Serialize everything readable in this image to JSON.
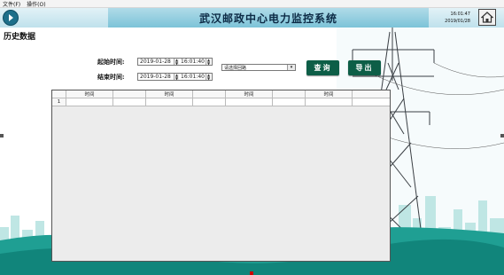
{
  "menu": [
    "文件(F)",
    "操作(O)"
  ],
  "header": {
    "title": "武汉邮政中心电力监控系统",
    "time": "16:01:47",
    "date": "2019/01/28"
  },
  "page_title": "历史数据",
  "form": {
    "start_label": "起始时间:",
    "end_label": "结束时间:",
    "start_date": "2019-01-28",
    "start_time": "16:01:40",
    "end_date": "2019-01-28",
    "end_time": "16:01:40",
    "circuit_placeholder": "请选择回路"
  },
  "buttons": {
    "query": "查询",
    "export": "导出"
  },
  "table": {
    "columns": [
      "",
      "时间",
      "",
      "时间",
      "",
      "时间",
      "",
      "时间",
      ""
    ],
    "rows": [
      [
        "1",
        "",
        "",
        "",
        "",
        "",
        "",
        "",
        ""
      ]
    ]
  },
  "colors": {
    "button_bg": "#0d5e47",
    "title_band": "#7cc3d8",
    "teal_ground": "#1f9f93"
  }
}
